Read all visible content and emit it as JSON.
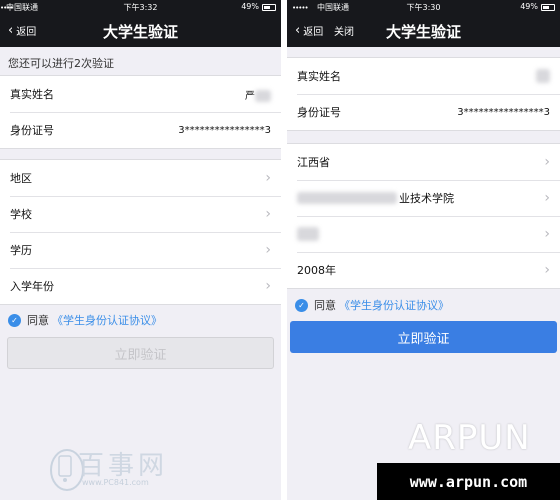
{
  "left": {
    "status": {
      "carrier": "中国联通",
      "time": "下午3:32",
      "battery": "49%"
    },
    "nav": {
      "back": "返回",
      "title": "大学生验证"
    },
    "hint": "您还可以进行2次验证",
    "identity": [
      {
        "label": "真实姓名",
        "value": "严"
      },
      {
        "label": "身份证号",
        "value": "3****************3"
      }
    ],
    "fields": [
      {
        "label": "地区"
      },
      {
        "label": "学校"
      },
      {
        "label": "学历"
      },
      {
        "label": "入学年份"
      }
    ],
    "agree": {
      "label": "同意",
      "link": "《学生身份认证协议》"
    },
    "submit": "立即验证"
  },
  "right": {
    "status": {
      "carrier": "中国联通",
      "time": "下午3:30",
      "battery": "49%"
    },
    "nav": {
      "back": "返回",
      "close": "关闭",
      "title": "大学生验证"
    },
    "identity": [
      {
        "label": "真实姓名",
        "value": ""
      },
      {
        "label": "身份证号",
        "value": "3****************3"
      }
    ],
    "fields": [
      {
        "value": "江西省"
      },
      {
        "value": "业技术学院"
      },
      {
        "value": ""
      },
      {
        "value": "2008年"
      }
    ],
    "agree": {
      "label": "同意",
      "link": "《学生身份认证协议》"
    },
    "submit": "立即验证"
  },
  "watermark": {
    "brand": "ARPUN",
    "url": "www.arpun.com",
    "logo_name": "百事网",
    "logo_url": "www.PC841.com"
  },
  "colors": {
    "accent": "#3a7ee3",
    "navbar": "#17181c",
    "background": "#f0eff5"
  }
}
